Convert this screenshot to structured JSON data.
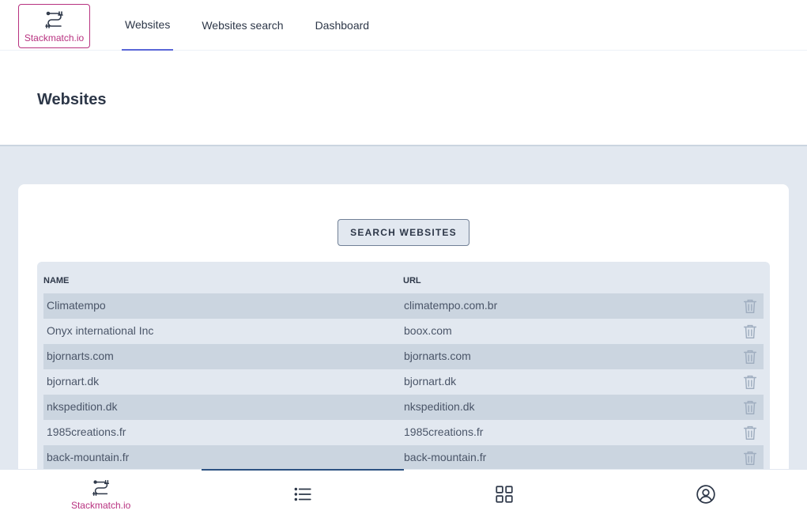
{
  "app": {
    "name": "Stackmatch.io"
  },
  "nav": {
    "items": [
      {
        "label": "Websites",
        "active": true
      },
      {
        "label": "Websites search",
        "active": false
      },
      {
        "label": "Dashboard",
        "active": false
      }
    ]
  },
  "page": {
    "title": "Websites"
  },
  "search": {
    "button_label": "SEARCH WEBSITES"
  },
  "table": {
    "columns": [
      "NAME",
      "URL"
    ],
    "rows": [
      {
        "name": "Climatempo",
        "url": "climatempo.com.br"
      },
      {
        "name": "Onyx international Inc",
        "url": "boox.com"
      },
      {
        "name": "bjornarts.com",
        "url": "bjornarts.com"
      },
      {
        "name": "bjornart.dk",
        "url": "bjornart.dk"
      },
      {
        "name": "nkspedition.dk",
        "url": "nkspedition.dk"
      },
      {
        "name": "1985creations.fr",
        "url": "1985creations.fr"
      },
      {
        "name": "back-mountain.fr",
        "url": "back-mountain.fr"
      }
    ]
  },
  "bottom_nav": {
    "tabs": [
      {
        "icon": "stackmatch-logo-icon",
        "label": "Stackmatch.io"
      },
      {
        "icon": "list-icon",
        "active": true
      },
      {
        "icon": "grid-icon"
      },
      {
        "icon": "user-circle-icon"
      }
    ]
  },
  "colors": {
    "brand": "#b83280",
    "accent": "#5a67d8",
    "background": "#e2e8f0"
  }
}
